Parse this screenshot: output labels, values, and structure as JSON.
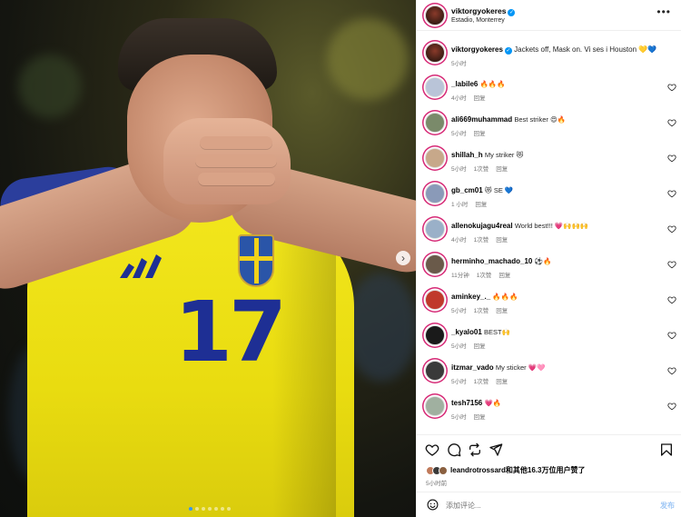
{
  "post": {
    "number": "17",
    "carousel_dots": 7,
    "active_dot": 0
  },
  "header": {
    "username": "viktorgyokeres",
    "location": "Estadio, Monterrey",
    "more_icon": "more-horizontal-icon"
  },
  "caption": {
    "username": "viktorgyokeres",
    "text": "Jackets off, Mask on. Vi ses i Houston 💛💙",
    "time": "5小时"
  },
  "comments": [
    {
      "user": "_labile6",
      "text": "🔥🔥🔥",
      "time": "4小时",
      "reply": "回复",
      "likes": ""
    },
    {
      "user": "ali669muhammad",
      "text": "Best striker 😍🔥",
      "time": "5小时",
      "reply": "回复",
      "likes": ""
    },
    {
      "user": "shillah_h",
      "text": "My striker 😻",
      "time": "5小时",
      "reply": "回复",
      "likes": "1次赞"
    },
    {
      "user": "gb_cm01",
      "text": "😻 SE 💙",
      "time": "1 小时",
      "reply": "回复",
      "likes": ""
    },
    {
      "user": "allenokujagu4real",
      "text": "World best!!! 💗🙌🙌🙌",
      "time": "4小时",
      "reply": "回复",
      "likes": "1次赞"
    },
    {
      "user": "herminho_machado_10",
      "text": "⚽🔥",
      "time": "11分钟",
      "reply": "回复",
      "likes": "1次赞"
    },
    {
      "user": "aminkey_._",
      "text": "🔥🔥🔥",
      "time": "5小时",
      "reply": "回复",
      "likes": "1次赞"
    },
    {
      "user": "_kyalo01",
      "text": "BEST🙌",
      "time": "5小时",
      "reply": "回复",
      "likes": ""
    },
    {
      "user": "itzmar_vado",
      "text": "My sticker 💗🩷",
      "time": "5小时",
      "reply": "回复",
      "likes": "1次赞"
    },
    {
      "user": "tesh7156",
      "text": "💗🔥",
      "time": "5小时",
      "reply": "回复",
      "likes": ""
    }
  ],
  "actions": {
    "icons": [
      "heart-icon",
      "comment-icon",
      "repost-icon",
      "share-icon",
      "bookmark-icon"
    ],
    "likes_text": "leandrotrossard和其他16.3万位用户赞了",
    "time": "5小时前"
  },
  "composer": {
    "placeholder": "添加评论...",
    "post_label": "发布"
  },
  "colors": {
    "jersey": "#f2e61c",
    "number": "#1e2f94",
    "link": "#0095f6",
    "post_disabled": "#9fc7f5"
  }
}
